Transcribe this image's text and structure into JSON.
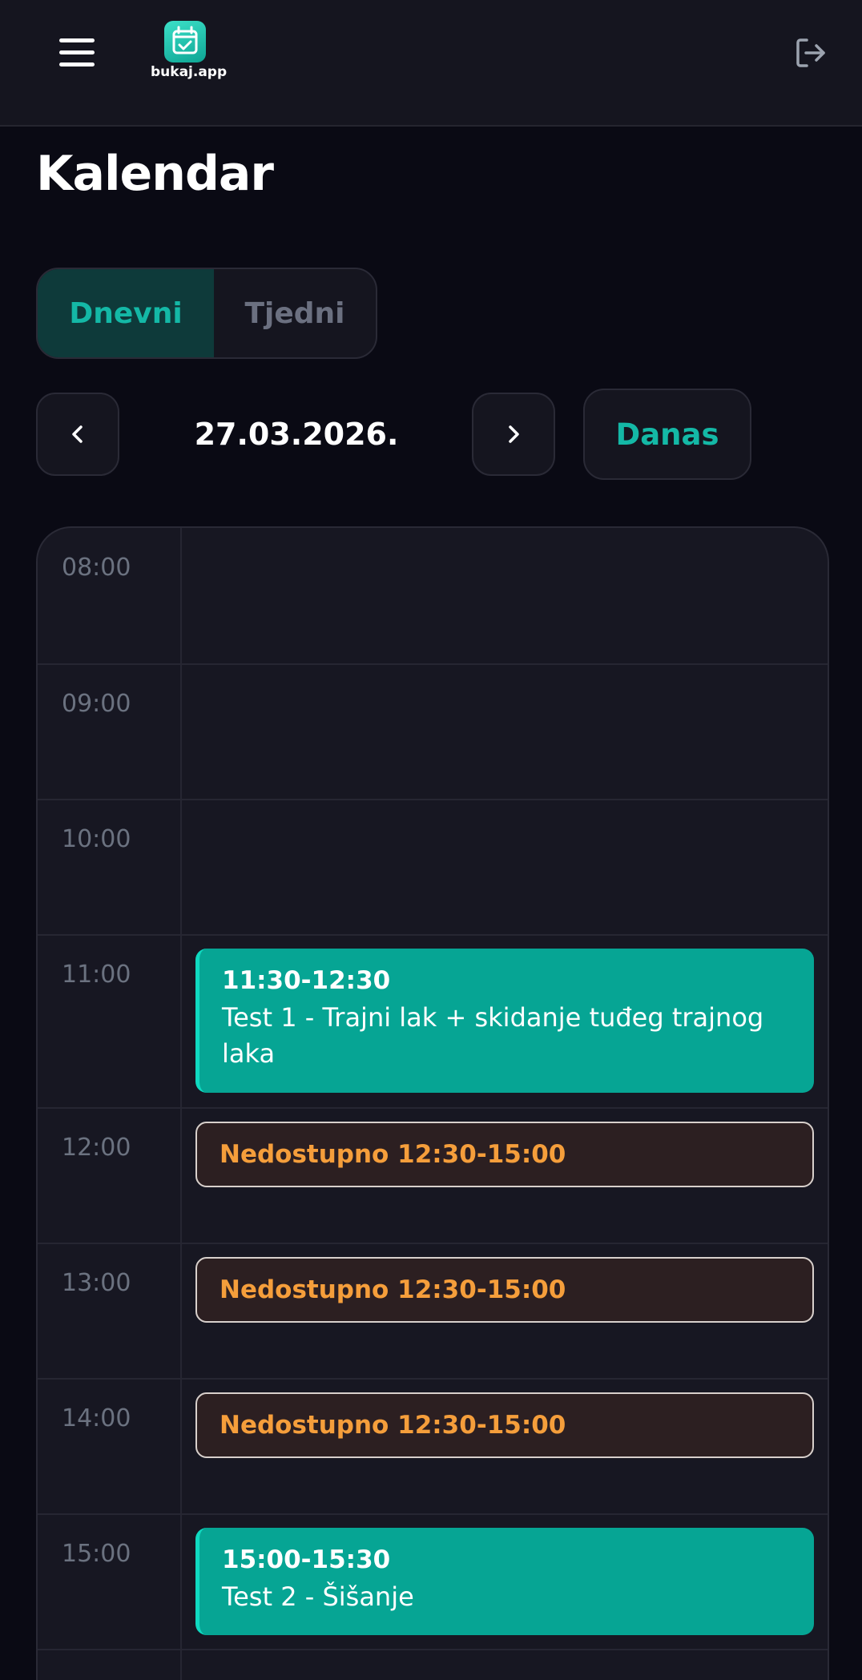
{
  "header": {
    "menu_icon": "hamburger-menu-icon",
    "logo_icon": "calendar-check-icon",
    "logo_text": "bukaj.app",
    "logout_icon": "logout-icon"
  },
  "page": {
    "title": "Kalendar"
  },
  "view_toggle": {
    "daily_label": "Dnevni",
    "weekly_label": "Tjedni",
    "selected": "Dnevni"
  },
  "date_nav": {
    "prev_icon": "chevron-left-icon",
    "next_icon": "chevron-right-icon",
    "current_date": "27.03.2026.",
    "today_label": "Danas"
  },
  "calendar": {
    "hours": [
      "08:00",
      "09:00",
      "10:00",
      "11:00",
      "12:00",
      "13:00",
      "14:00",
      "15:00"
    ],
    "events": [
      {
        "type": "booked",
        "time": "11:30-12:30",
        "title": "Test 1 - Trajni lak + skidanje tuđeg trajnog laka"
      },
      {
        "type": "unavailable",
        "label": "Nedostupno 12:30-15:00"
      },
      {
        "type": "unavailable",
        "label": "Nedostupno 12:30-15:00"
      },
      {
        "type": "unavailable",
        "label": "Nedostupno 12:30-15:00"
      },
      {
        "type": "booked",
        "time": "15:00-15:30",
        "title": "Test 2 - Šišanje"
      }
    ]
  },
  "colors": {
    "background": "#0a0a14",
    "surface": "#15151f",
    "accent": "#14b8a6",
    "booked_event": "#06a594",
    "unavailable_text": "#f59e3b",
    "unavailable_bg": "#2c1f21"
  }
}
